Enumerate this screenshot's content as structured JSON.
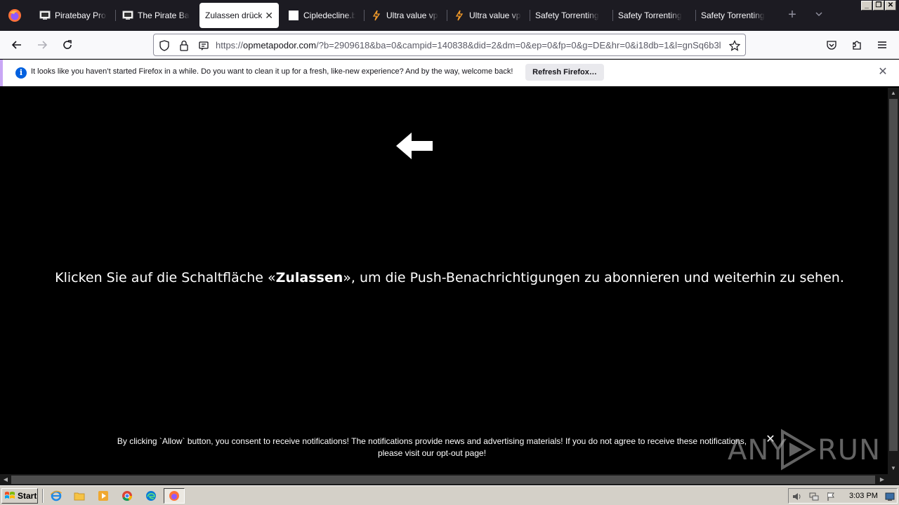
{
  "browser": {
    "tabs": [
      {
        "label": "Piratebay Proxy",
        "favicon": "pirate-monitor-icon",
        "active": false
      },
      {
        "label": "The Pirate Bay",
        "favicon": "pirate-monitor-icon",
        "active": false
      },
      {
        "label": "Zulassen drücken",
        "favicon": "",
        "active": true
      },
      {
        "label": "Cipledecline.bu",
        "favicon": "blank-page-icon",
        "active": false
      },
      {
        "label": "Ultra value vpn",
        "favicon": "lightning-icon",
        "active": false
      },
      {
        "label": "Ultra value vpn",
        "favicon": "lightning-icon",
        "active": false
      },
      {
        "label": "Safety Torrenting",
        "favicon": "",
        "active": false
      },
      {
        "label": "Safety Torrenting",
        "favicon": "",
        "active": false
      },
      {
        "label": "Safety Torrenting",
        "favicon": "",
        "active": false
      }
    ],
    "url": {
      "scheme": "https://",
      "host": "opmetapodor.com",
      "rest": "/?b=2909618&ba=0&campid=140838&did=2&dm=0&ep=0&fp=0&g=DE&hr=0&i18db=1&l=gnSq6b3l"
    }
  },
  "notification": {
    "text": "It looks like you haven’t started Firefox in a while. Do you want to clean it up for a fresh, like-new experience? And by the way, welcome back!",
    "button": "Refresh Firefox…"
  },
  "page": {
    "message_before": "Klicken Sie auf die Schaltfläche «",
    "message_bold": "Zulassen",
    "message_after": "», um die Push-Benachrichtigungen zu abonnieren und weiterhin zu sehen.",
    "consent_line1": "By clicking `Allow` button, you consent to receive notifications! The notifications provide news and advertising materials! If you do not agree to receive these notifications,",
    "consent_line2_prefix": "please visit our ",
    "consent_link": "opt-out page!",
    "watermark_left": "ANY",
    "watermark_right": "RUN"
  },
  "taskbar": {
    "start_label": "Start",
    "quick_launch": [
      "ie-icon",
      "explorer-folder-icon",
      "media-player-icon",
      "chrome-icon",
      "edge-icon"
    ],
    "active_app": "firefox-icon",
    "tray_icons": [
      "volume-icon",
      "network-icon",
      "flag-icon"
    ],
    "clock": "3:03 PM"
  },
  "colors": {
    "tabstrip_bg": "#1c1b22",
    "page_bg": "#000000",
    "notif_accent": "#c9a7f5",
    "info_blue": "#0060df"
  }
}
